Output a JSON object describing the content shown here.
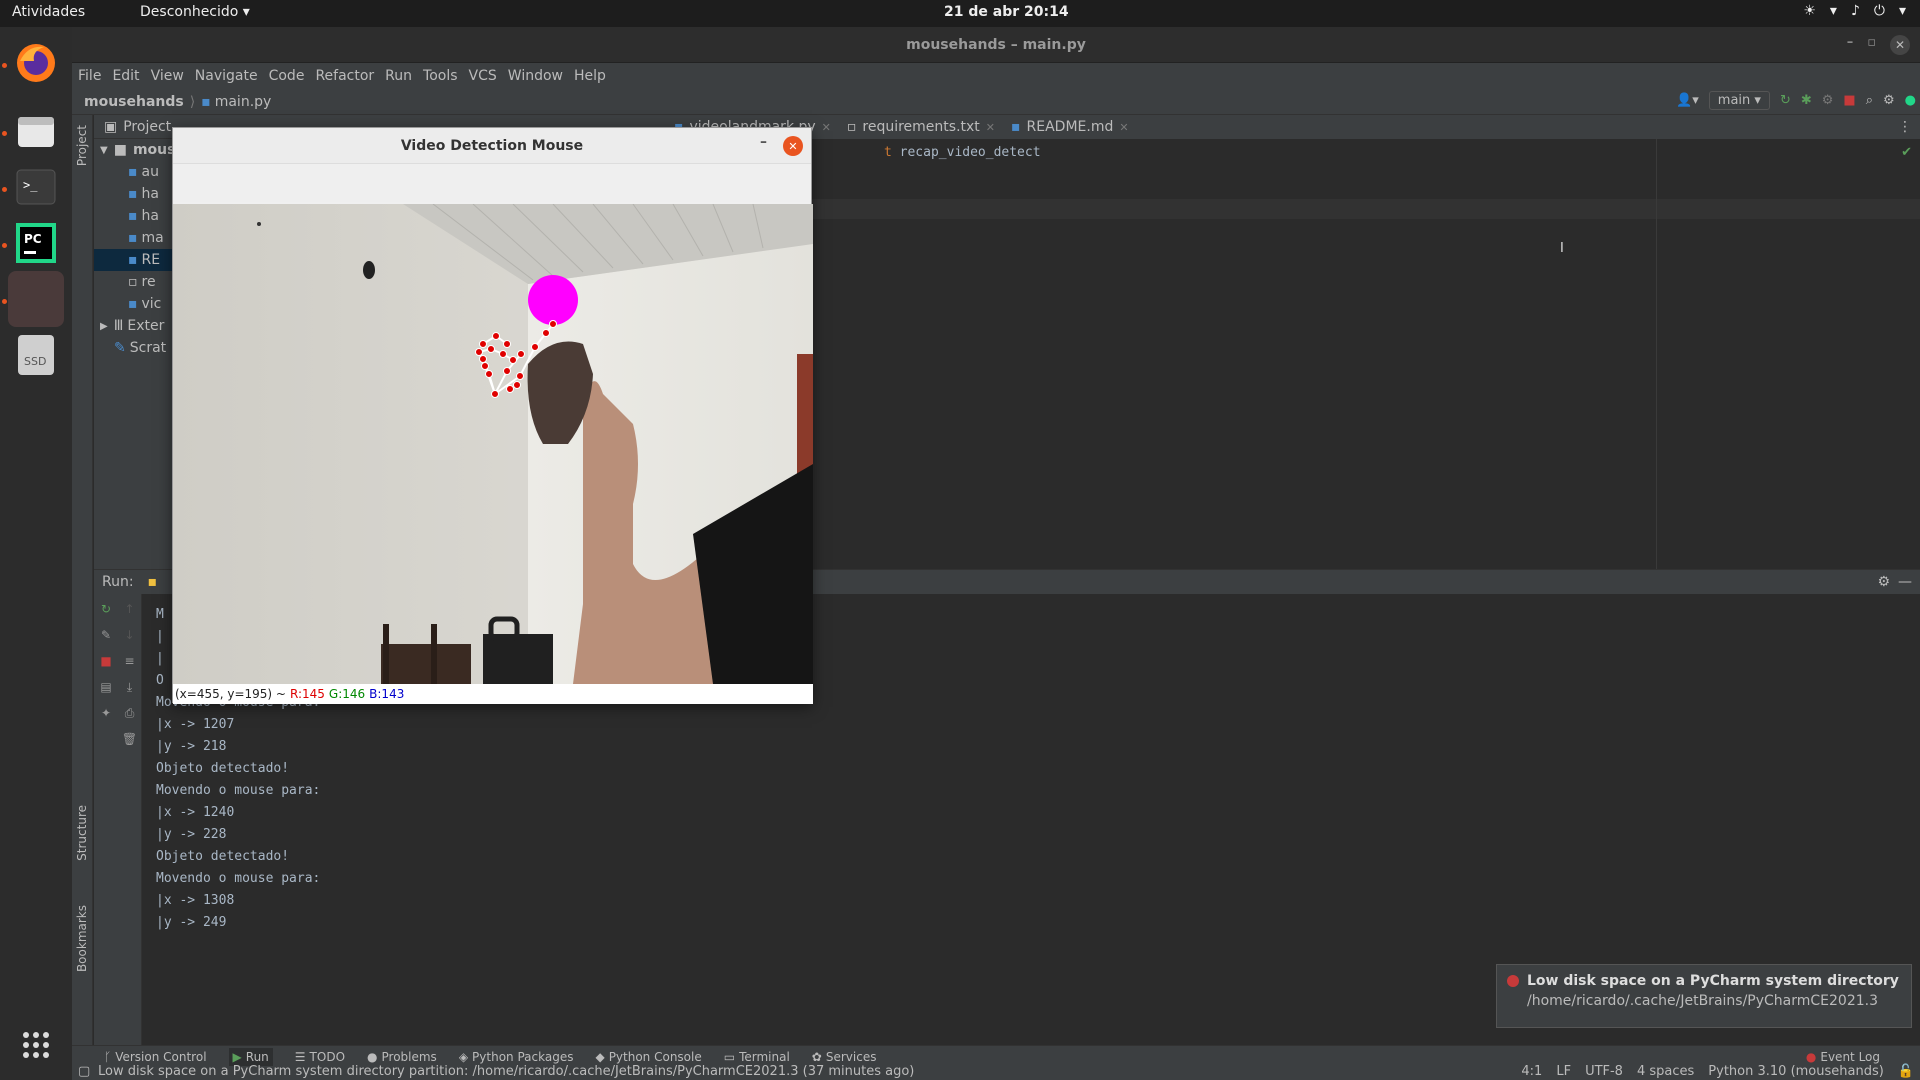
{
  "topbar": {
    "activities": "Atividades",
    "app_menu": "Desconhecido ▾",
    "clock": "21 de abr  20:14"
  },
  "window": {
    "title": "mousehands – main.py"
  },
  "menu": [
    "File",
    "Edit",
    "View",
    "Navigate",
    "Code",
    "Refactor",
    "Run",
    "Tools",
    "VCS",
    "Window",
    "Help"
  ],
  "nav": {
    "project": "mousehands",
    "file": "main.py",
    "run_config": "main"
  },
  "project_panel": {
    "title": "Project",
    "items": [
      {
        "label": "mous",
        "sel": false
      },
      {
        "label": "au",
        "sel": false
      },
      {
        "label": "ha",
        "sel": false
      },
      {
        "label": "ha",
        "sel": false
      },
      {
        "label": "ma",
        "sel": false
      },
      {
        "label": "RE",
        "sel": true
      },
      {
        "label": "re",
        "sel": false
      },
      {
        "label": "vic",
        "sel": false
      },
      {
        "label": "Exter",
        "sel": false
      },
      {
        "label": "Scrat",
        "sel": false
      }
    ]
  },
  "tabs": [
    "videolandmark.py",
    "requirements.txt",
    "README.md"
  ],
  "editor": {
    "line_fragment_kw": "t",
    "line_fragment_rest": " recap_video_detect"
  },
  "run": {
    "label": "Run:",
    "console_lines": [
      "M",
      "|",
      "|",
      "",
      "O",
      "Movendo o mouse para:",
      "|x -> 1207",
      "|y -> 218",
      "",
      "Objeto detectado!",
      "Movendo o mouse para:",
      "|x -> 1240",
      "|y -> 228",
      "",
      "Objeto detectado!",
      "Movendo o mouse para:",
      "|x -> 1308",
      "|y -> 249"
    ]
  },
  "cv_window": {
    "title": "Video Detection Mouse",
    "status_coords": "(x=455, y=195) ~",
    "status_r": "R:145",
    "status_g": "G:146",
    "status_b": "B:143"
  },
  "bottom_tools": [
    "Version Control",
    "Run",
    "TODO",
    "Problems",
    "Python Packages",
    "Python Console",
    "Terminal",
    "Services"
  ],
  "event_log": "Event Log",
  "status": {
    "message": "Low disk space on a PyCharm system directory partition: /home/ricardo/.cache/JetBrains/PyCharmCE2021.3 (37 minutes ago)",
    "position": "4:1",
    "line_sep": "LF",
    "encoding": "UTF-8",
    "indent": "4 spaces",
    "interpreter": "Python 3.10 (mousehands)"
  },
  "notification": {
    "title": "Low disk space on a PyCharm system directory pa",
    "path": "/home/ricardo/.cache/JetBrains/PyCharmCE2021.3"
  },
  "dock": {
    "ssd_label": "SSD",
    "pc_label": "PC"
  },
  "colors": {
    "marker": "#ff00ff",
    "landmark": "#e00000",
    "accent": "#e95420"
  }
}
